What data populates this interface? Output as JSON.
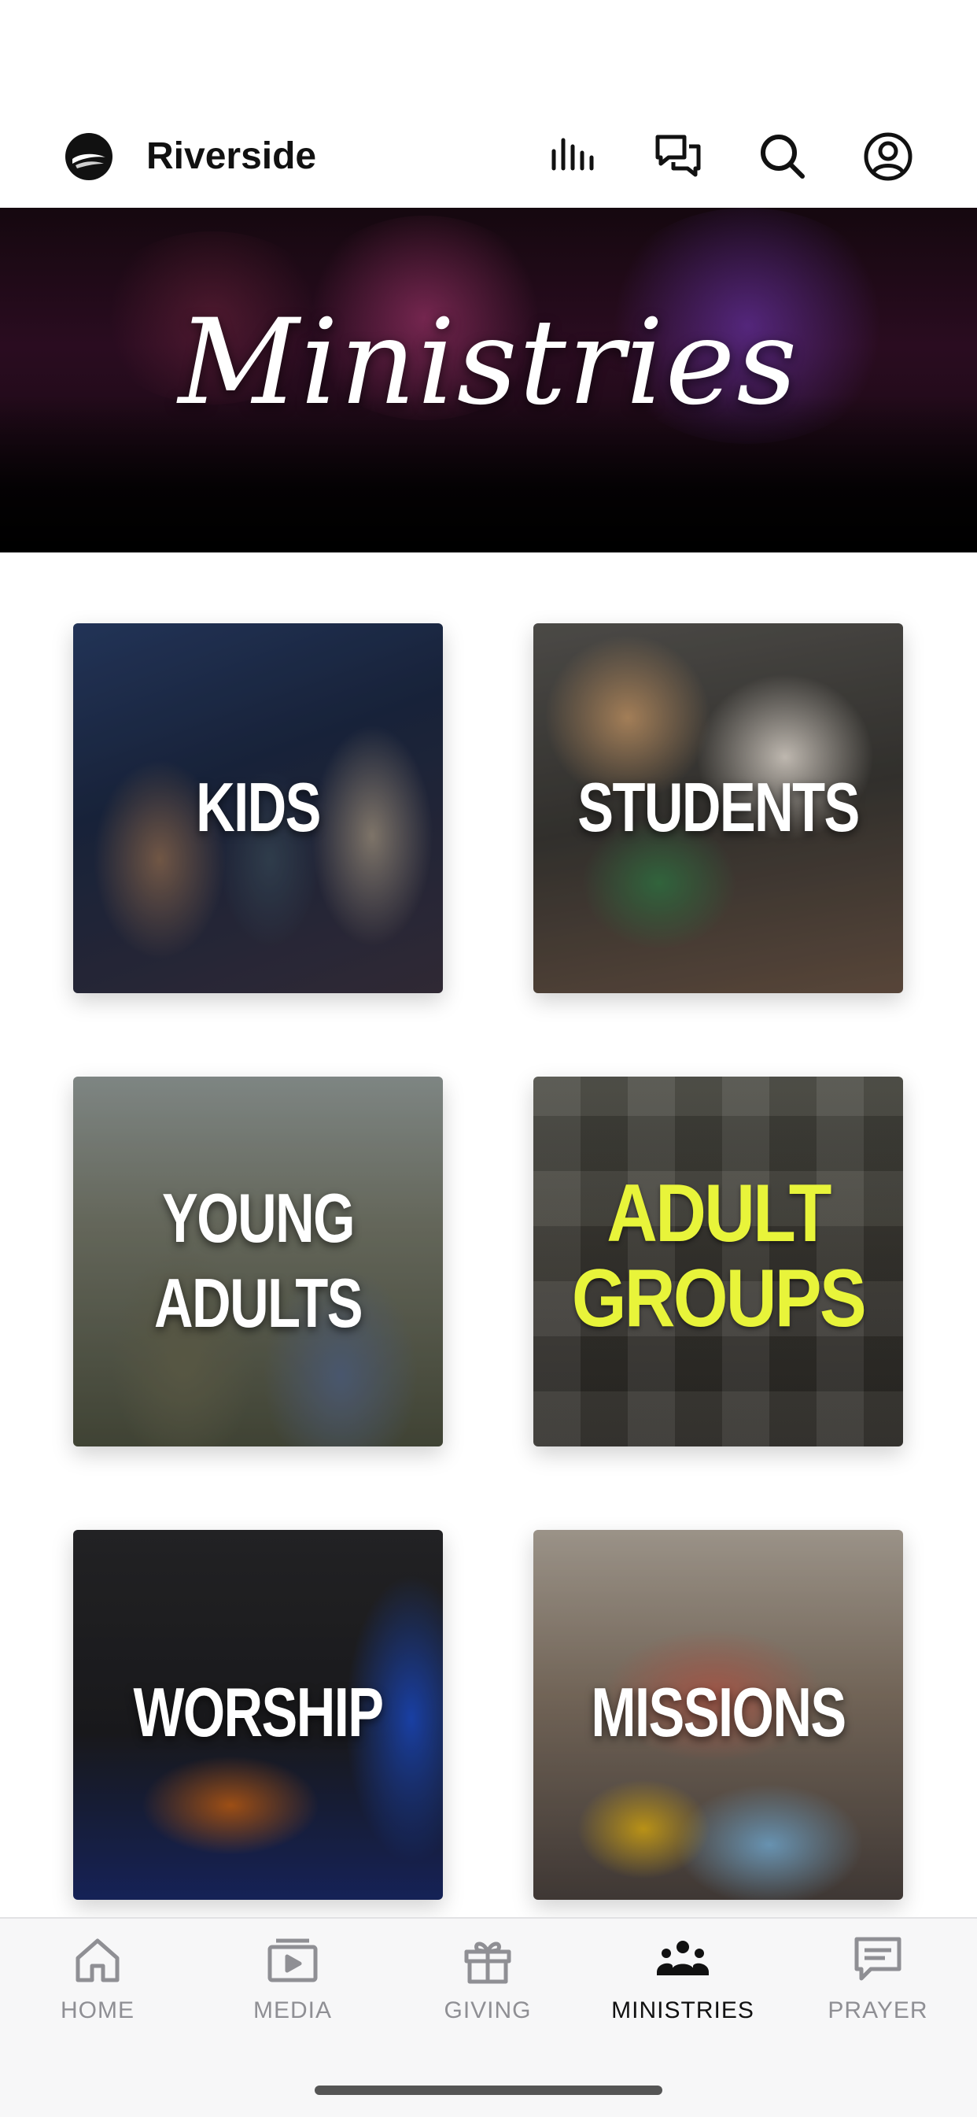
{
  "header": {
    "brand": "Riverside",
    "icons": [
      "stats-icon",
      "chat-icon",
      "search-icon",
      "account-icon"
    ]
  },
  "hero": {
    "title": "Ministries"
  },
  "ministries": [
    {
      "label": "KIDS"
    },
    {
      "label": "STUDENTS"
    },
    {
      "label_line1": "YOUNG",
      "label_line2": "ADULTS"
    },
    {
      "label_line1": "ADULT",
      "label_line2": "GROUPS"
    },
    {
      "label": "WORSHIP"
    },
    {
      "label": "MISSIONS"
    }
  ],
  "bottom_nav": {
    "items": [
      {
        "label": "HOME",
        "icon": "home-icon"
      },
      {
        "label": "MEDIA",
        "icon": "media-icon"
      },
      {
        "label": "GIVING",
        "icon": "gift-icon"
      },
      {
        "label": "MINISTRIES",
        "icon": "people-icon",
        "active": true
      },
      {
        "label": "PRAYER",
        "icon": "prayer-icon"
      }
    ]
  },
  "colors": {
    "accent": "#111111",
    "inactive": "#8f8f94",
    "adult_groups_yellow": "#e8f43a"
  }
}
